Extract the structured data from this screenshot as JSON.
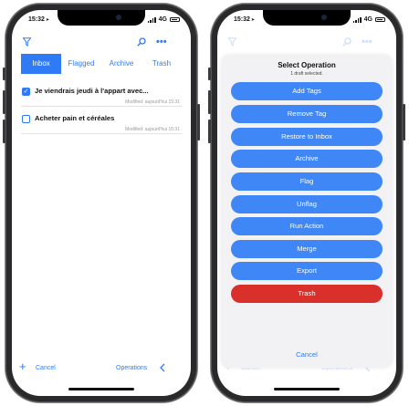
{
  "status": {
    "time": "15:32",
    "network": "4G"
  },
  "left": {
    "tabs": [
      {
        "label": "Inbox"
      },
      {
        "label": "Flagged"
      },
      {
        "label": "Archive"
      },
      {
        "label": "Trash"
      }
    ],
    "drafts": [
      {
        "title": "Je viendrais jeudi à l'appart avec...",
        "modified": "Modified: aujourd'hui 15:31",
        "checked": true
      },
      {
        "title": "Acheter pain et céréales",
        "modified": "Modified: aujourd'hui 15:31",
        "checked": false
      }
    ],
    "bottom": {
      "add": "+",
      "cancel": "Cancel",
      "operations": "Operations",
      "back": "<"
    }
  },
  "right": {
    "sheet": {
      "title": "Select Operation",
      "subtitle": "1 draft selected.",
      "operations": [
        {
          "label": "Add Tags"
        },
        {
          "label": "Remove Tag"
        },
        {
          "label": "Restore to Inbox"
        },
        {
          "label": "Archive"
        },
        {
          "label": "Flag"
        },
        {
          "label": "Unflag"
        },
        {
          "label": "Run Action"
        },
        {
          "label": "Merge"
        },
        {
          "label": "Export"
        },
        {
          "label": "Trash",
          "style": "destructive"
        }
      ],
      "cancel": "Cancel"
    },
    "background": {
      "cancel": "Cancel",
      "operations": "Operations"
    }
  },
  "colors": {
    "accent": "#2f7bf5",
    "button": "#3f86f6",
    "destructive": "#d9302c"
  },
  "icons": [
    "filter-icon",
    "search-icon",
    "more-icon",
    "checkbox-icon",
    "plus-icon",
    "chevron-left-icon"
  ]
}
